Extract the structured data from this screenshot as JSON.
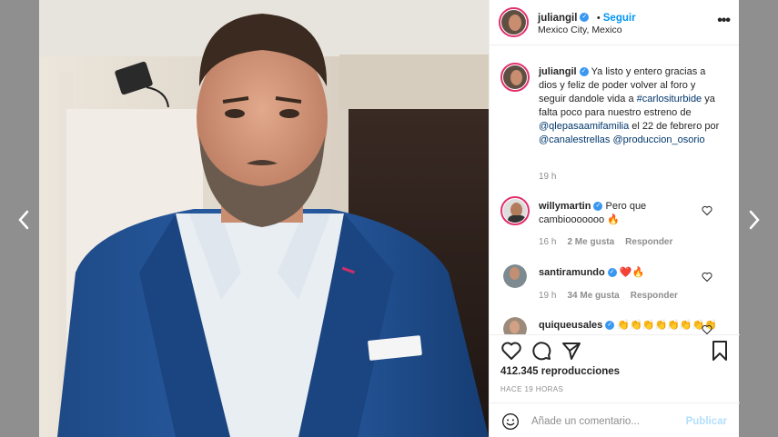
{
  "post": {
    "author": "juliangil",
    "follow_label": "Seguir",
    "dot": "•",
    "location": "Mexico City, Mexico",
    "more_label": "•••",
    "caption_parts": [
      {
        "text": "Ya listo y entero gracias a dios y feliz de poder volver al foro y seguir dandole vida a ",
        "kind": "text"
      },
      {
        "text": "#carlositurbide",
        "kind": "tag"
      },
      {
        "text": " ya falta poco para nuestro estreno de ",
        "kind": "text"
      },
      {
        "text": "@qlepasaamifamilia",
        "kind": "tag"
      },
      {
        "text": " el 22 de febrero por ",
        "kind": "text"
      },
      {
        "text": "@canalestrellas",
        "kind": "tag"
      },
      {
        "text": " ",
        "kind": "text"
      },
      {
        "text": "@produccion_osorio",
        "kind": "tag"
      }
    ],
    "caption_time": "19 h",
    "views": "412.345 reproducciones",
    "posted_ago": "HACE 19 HORAS"
  },
  "comments": [
    {
      "user": "willymartin",
      "text": "Pero que cambiooooooo 🔥",
      "time": "16 h",
      "likes": "2 Me gusta",
      "reply": "Responder"
    },
    {
      "user": "santiramundo",
      "text": "❤️🔥",
      "time": "19 h",
      "likes": "34 Me gusta",
      "reply": "Responder"
    },
    {
      "user": "quiqueusales",
      "text": "👏👏👏👏👏👏👏👏",
      "time": "",
      "likes": "",
      "reply": ""
    }
  ],
  "composer": {
    "placeholder": "Añade un comentario...",
    "post_label": "Publicar"
  },
  "colors": {
    "accent": "#0095f6",
    "verified": "#3897f0",
    "story_ring": "#e1306c",
    "backdrop": "#8f8f8f"
  },
  "icons": [
    "chevron-left-icon",
    "chevron-right-icon",
    "heart-icon",
    "comment-icon",
    "share-icon",
    "bookmark-icon",
    "emoji-icon",
    "speaker-icon",
    "verified-icon",
    "more-icon"
  ]
}
